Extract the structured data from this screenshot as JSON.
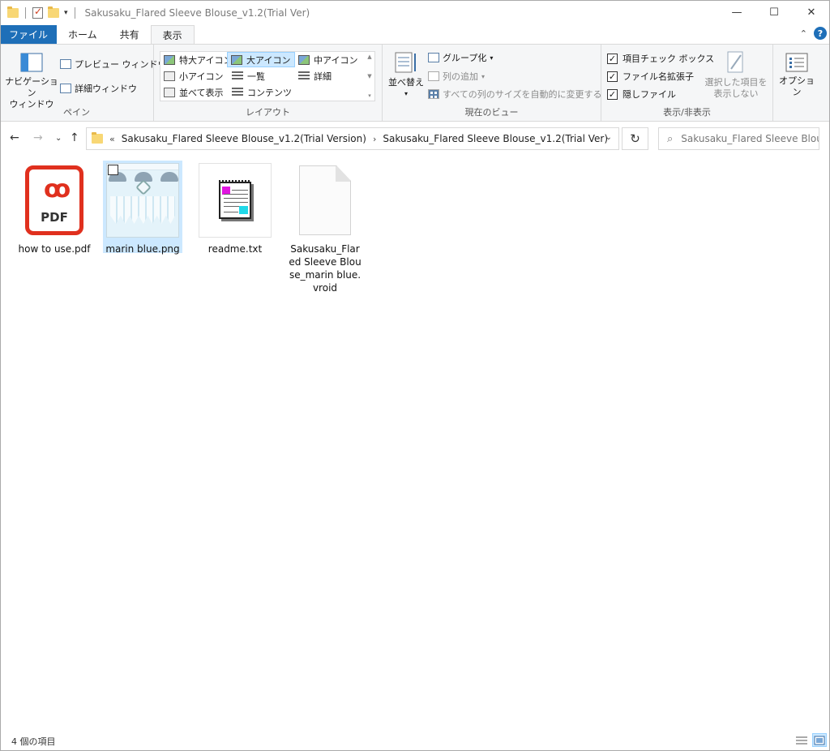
{
  "window": {
    "title": "Sakusaku_Flared Sleeve Blouse_v1.2(Trial Ver)",
    "minimize": "—",
    "maximize": "☐",
    "close": "✕"
  },
  "tabs": [
    {
      "label": "ファイル"
    },
    {
      "label": "ホーム"
    },
    {
      "label": "共有"
    },
    {
      "label": "表示"
    }
  ],
  "ribbon": {
    "pane": {
      "navigation_pane": "ナビゲーション\nウィンドウ",
      "preview_pane": "プレビュー ウィンドウ",
      "details_pane": "詳細ウィンドウ",
      "label": "ペイン"
    },
    "layout": {
      "items": [
        "特大アイコン",
        "大アイコン",
        "中アイコン",
        "小アイコン",
        "一覧",
        "詳細",
        "並べて表示",
        "コンテンツ"
      ],
      "label": "レイアウト"
    },
    "current_view": {
      "sort": "並べ替え",
      "group_by": "グループ化",
      "add_columns": "列の追加",
      "size_all_columns": "すべての列のサイズを自動的に変更する",
      "label": "現在のビュー"
    },
    "show_hide": {
      "item_checkboxes": "項目チェック ボックス",
      "file_extensions": "ファイル名拡張子",
      "hidden_items": "隠しファイル",
      "hide_selected": "選択した項目を\n表示しない",
      "label": "表示/非表示"
    },
    "options": {
      "label": "オプション"
    }
  },
  "address": {
    "crumbs": [
      "Sakusaku_Flared Sleeve Blouse_v1.2(Trial Version)",
      "Sakusaku_Flared Sleeve Blouse_v1.2(Trial Ver)"
    ],
    "search_placeholder": "Sakusaku_Flared Sleeve Blou..."
  },
  "files": [
    {
      "name": "how to use.pdf",
      "type": "pdf",
      "icon_label": "PDF"
    },
    {
      "name": "marin blue.png",
      "type": "png"
    },
    {
      "name": "readme.txt",
      "type": "txt"
    },
    {
      "name": "Sakusaku_Flared Sleeve Blouse_marin blue.vroid",
      "type": "generic"
    }
  ],
  "status": {
    "item_count": "4 個の項目"
  }
}
